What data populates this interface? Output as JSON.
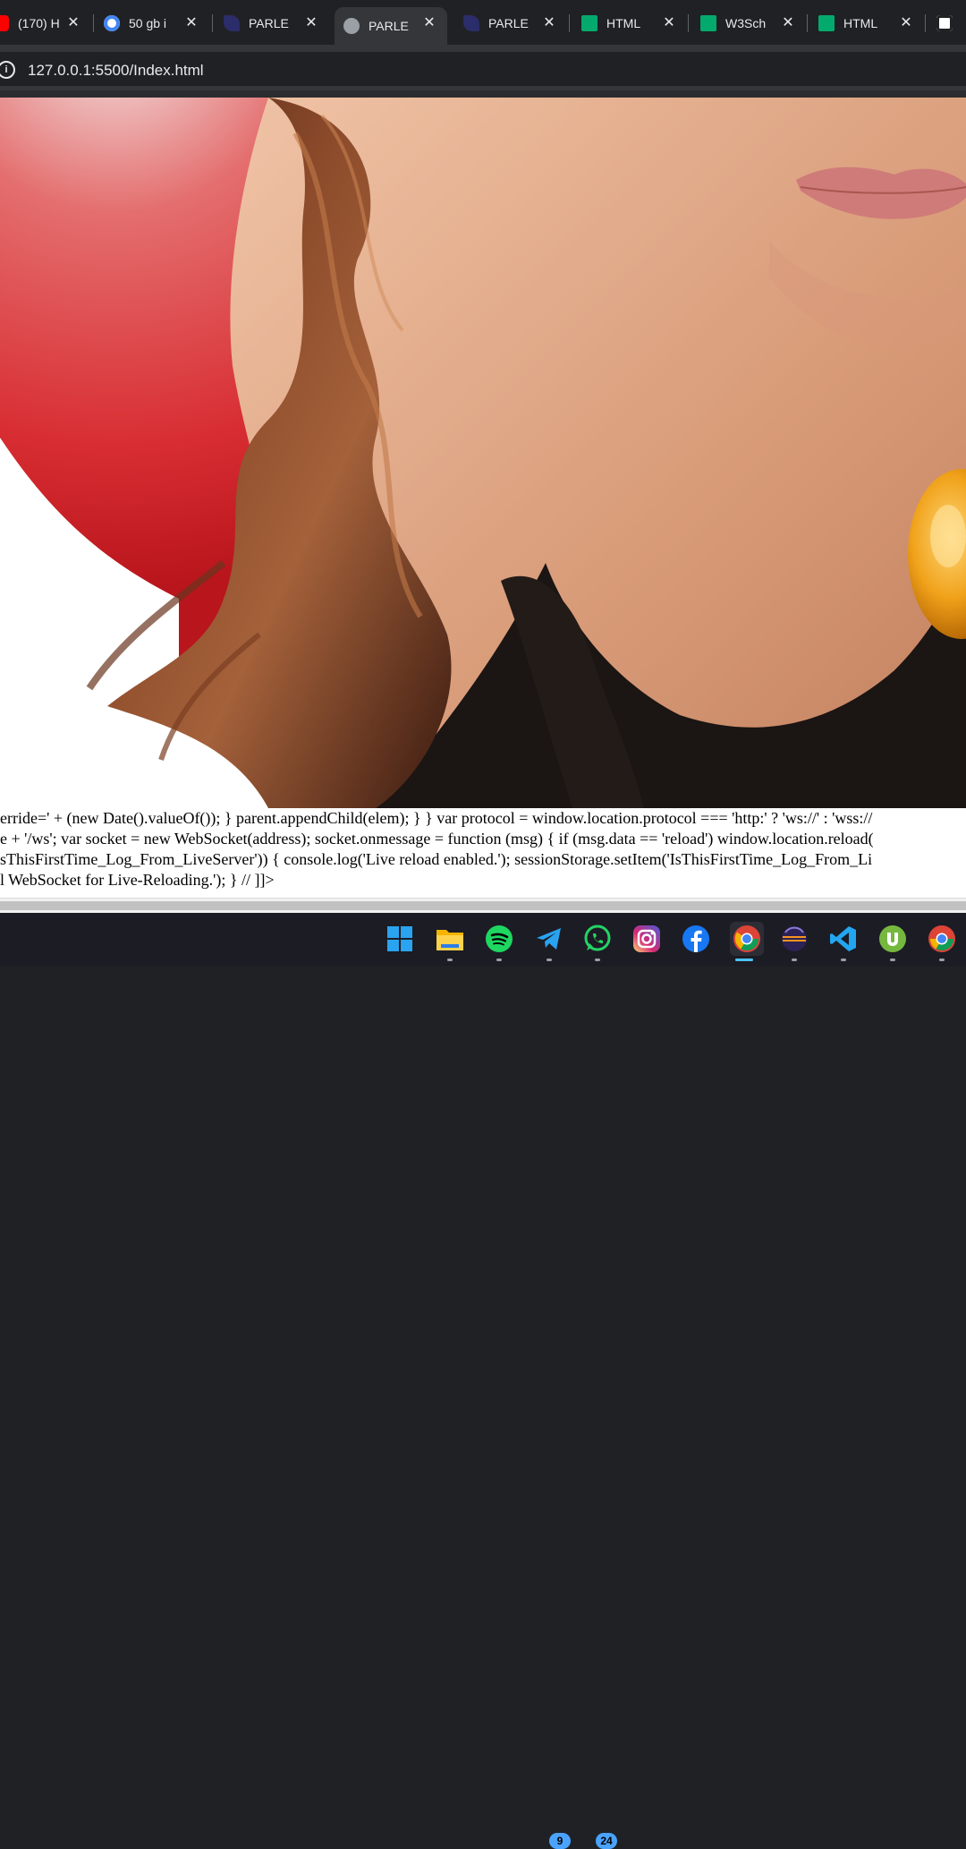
{
  "browser": {
    "tabs": [
      {
        "label": "(170) H",
        "favicon": "youtube-icon",
        "active": false
      },
      {
        "label": "50 gb i",
        "favicon": "google-icon",
        "active": false
      },
      {
        "label": "PARLE",
        "favicon": "parle-icon",
        "active": false
      },
      {
        "label": "PARLE",
        "favicon": "globe-icon",
        "active": true
      },
      {
        "label": "PARLE",
        "favicon": "parle-icon",
        "active": false
      },
      {
        "label": "HTML",
        "favicon": "w3schools-icon",
        "active": false
      },
      {
        "label": "W3Sch",
        "favicon": "w3schools-icon",
        "active": false
      },
      {
        "label": "HTML",
        "favicon": "w3schools-icon",
        "active": false
      }
    ],
    "close_glyph": "✕",
    "url": "127.0.0.1:5500/Index.html"
  },
  "page": {
    "code_lines": [
      "erride=' + (new Date().valueOf()); } parent.appendChild(elem); } } var protocol = window.location.protocol === 'http:' ? 'ws://' : 'wss://",
      "e + '/ws'; var socket = new WebSocket(address); socket.onmessage = function (msg) { if (msg.data == 'reload') window.location.reload(",
      "sThisFirstTime_Log_From_LiveServer')) { console.log('Live reload enabled.'); sessionStorage.setItem('IsThisFirstTime_Log_From_Li",
      "l WebSocket for Live-Reloading.'); } // ]]>"
    ]
  },
  "taskbar": {
    "apps": [
      {
        "name": "windows-start-icon"
      },
      {
        "name": "file-explorer-icon"
      },
      {
        "name": "spotify-icon"
      },
      {
        "name": "telegram-icon",
        "badge": "9"
      },
      {
        "name": "whatsapp-icon",
        "badge": "24"
      },
      {
        "name": "instagram-icon"
      },
      {
        "name": "facebook-icon"
      },
      {
        "name": "chrome-icon"
      },
      {
        "name": "eclipse-icon"
      },
      {
        "name": "vscode-icon"
      },
      {
        "name": "utorrent-icon"
      },
      {
        "name": "chrome-icon"
      }
    ]
  },
  "colors": {
    "chrome_dark": "#202124",
    "toolbar": "#35363a",
    "taskbar": "#1c1c24"
  }
}
